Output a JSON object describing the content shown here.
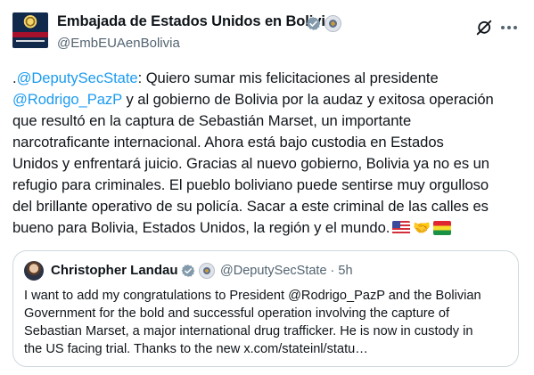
{
  "author": {
    "name": "Embajada de Estados Unidos en Bolivia",
    "handle": "@EmbEUAenBolivia"
  },
  "body": {
    "lines": [
      [
        {
          "t": "."
        },
        {
          "t": "@DeputySecState",
          "mention": true
        },
        {
          "t": ": Quiero sumar mis felicitaciones al presidente"
        }
      ],
      [
        {
          "t": "@Rodrigo_PazP",
          "mention": true
        },
        {
          "t": " y al gobierno de Bolivia por la audaz y exitosa operación"
        }
      ],
      [
        {
          "t": "que resultó en la captura de Sebastián Marset, un importante"
        }
      ],
      [
        {
          "t": "narcotraficante internacional. Ahora está bajo custodia en Estados"
        }
      ],
      [
        {
          "t": "Unidos y enfrentará juicio. Gracias al nuevo gobierno, Bolivia ya no es un"
        }
      ],
      [
        {
          "t": "refugio para criminales. El pueblo boliviano puede sentirse muy orgulloso"
        }
      ],
      [
        {
          "t": "del brillante operativo de su policía. Sacar a este criminal de las calles es"
        }
      ],
      [
        {
          "t": "bueno para Bolivia, Estados Unidos, la región y el mundo."
        }
      ]
    ],
    "emojis": [
      "us-flag",
      "handshake",
      "bolivia-flag"
    ],
    "handshake_glyph": "🤝"
  },
  "quote": {
    "name": "Christopher Landau",
    "handle": "@DeputySecState",
    "time": "· 5h",
    "lines": [
      "I want to add my congratulations to President @Rodrigo_PazP and the Bolivian",
      "Government for the bold and successful operation involving the capture of",
      "Sebastian Marset, a major international drug trafficker. He is now in custody in",
      "the US facing trial. Thanks to the new x.com/stateinl/statu…"
    ]
  },
  "icons": {
    "verified_color": "#1d9bf0",
    "grok": "grok-icon",
    "more": "more-icon"
  }
}
